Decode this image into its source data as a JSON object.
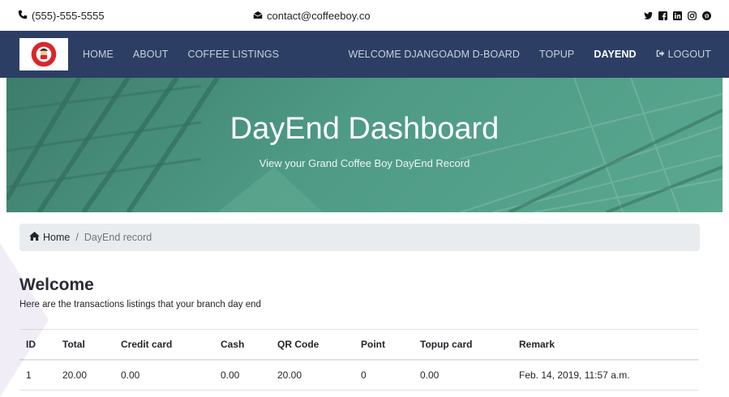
{
  "topbar": {
    "phone": "(555)-555-5555",
    "email": "contact@coffeeboy.co",
    "social": [
      {
        "icon": "twitter-icon",
        "glyph": "t"
      },
      {
        "icon": "facebook-icon",
        "glyph": "f"
      },
      {
        "icon": "linkedin-icon",
        "glyph": "in"
      },
      {
        "icon": "instagram-icon",
        "glyph": "◎"
      },
      {
        "icon": "pinterest-icon",
        "glyph": "p"
      }
    ]
  },
  "nav": {
    "left": [
      "HOME",
      "ABOUT",
      "COFFEE LISTINGS"
    ],
    "right": [
      "WELCOME DJANGOADM D-BOARD",
      "TOPUP",
      "DAYEND"
    ],
    "logout": "LOGOUT",
    "active": "DAYEND"
  },
  "hero": {
    "title": "DayEnd Dashboard",
    "subtitle": "View your Grand Coffee Boy DayEnd Record"
  },
  "breadcrumb": {
    "home": "Home",
    "current": "DayEnd record"
  },
  "main": {
    "heading": "Welcome",
    "description": "Here are the transactions listings that your branch day end"
  },
  "table": {
    "headers": [
      "ID",
      "Total",
      "Credit card",
      "Cash",
      "QR Code",
      "Point",
      "Topup card",
      "Remark"
    ],
    "rows": [
      [
        "1",
        "20.00",
        "0.00",
        "0.00",
        "20.00",
        "0",
        "0.00",
        "Feb. 14, 2019, 11:57 a.m."
      ]
    ]
  },
  "colors": {
    "navbar": "#2c3e64",
    "hero": "#4e9a85",
    "breadcrumb_bg": "#e9ecef"
  }
}
